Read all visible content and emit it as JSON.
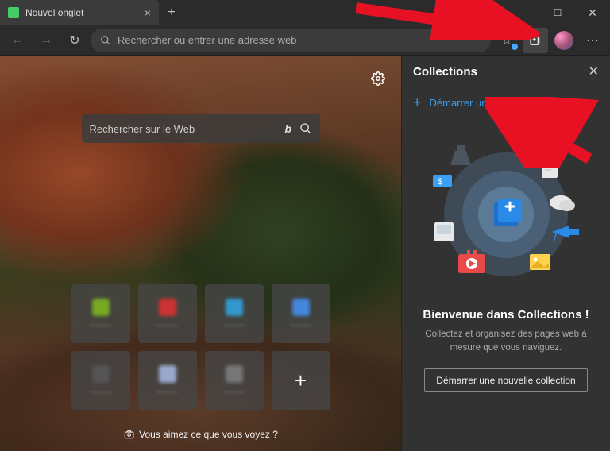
{
  "tab": {
    "title": "Nouvel onglet"
  },
  "addr": {
    "placeholder": "Rechercher ou entrer une adresse web"
  },
  "ntp": {
    "search_placeholder": "Rechercher sur le Web",
    "caption": "Vous aimez ce que vous voyez ?"
  },
  "tiles": [
    {
      "color": "#7a2",
      "label": "———"
    },
    {
      "color": "#c33",
      "label": "———"
    },
    {
      "color": "#39c",
      "label": "———"
    },
    {
      "color": "#48d",
      "label": "———"
    },
    {
      "color": "#555",
      "label": "———"
    },
    {
      "color": "#9ac",
      "label": "———"
    },
    {
      "color": "#777",
      "label": "———"
    }
  ],
  "panel": {
    "title": "Collections",
    "start": "Démarrer une nouvelle collection",
    "welcome_title": "Bienvenue dans Collections !",
    "welcome_body": "Collectez et organisez des pages web à mesure que vous naviguez.",
    "cta": "Démarrer une nouvelle collection"
  },
  "colors": {
    "accent": "#3aa0f3",
    "arrow": "#e81123"
  }
}
